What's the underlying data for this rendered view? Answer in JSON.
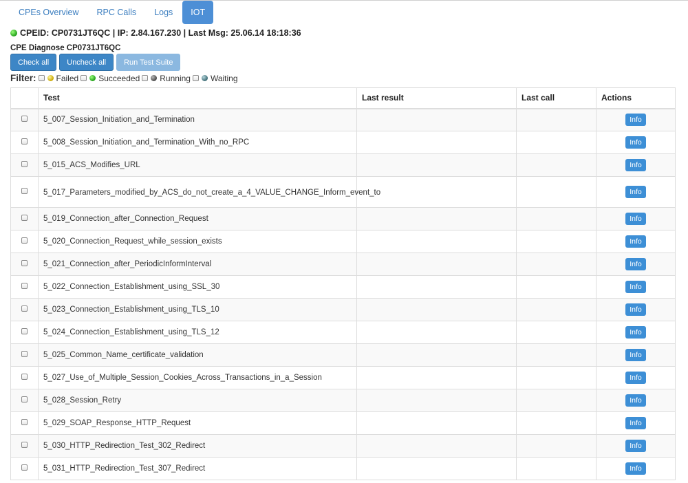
{
  "tabs": [
    {
      "label": "CPEs Overview",
      "active": false
    },
    {
      "label": "RPC Calls",
      "active": false
    },
    {
      "label": "Logs",
      "active": false
    },
    {
      "label": "IOT",
      "active": true
    }
  ],
  "status": {
    "text": "CPEID: CP0731JT6QC | IP: 2.84.167.230 | Last Msg: 25.06.14 18:18:36",
    "indicator_color": "#1f9e18"
  },
  "diagnose": {
    "title": "CPE Diagnose CP0731JT6QC",
    "buttons": {
      "check_all": "Check all",
      "uncheck_all": "Uncheck all",
      "run_suite": "Run Test Suite"
    }
  },
  "filter": {
    "label": "Filter:",
    "items": [
      {
        "label": "Failed",
        "icon": "yellow-dot-icon"
      },
      {
        "label": "Succeeded",
        "icon": "green-dot-icon"
      },
      {
        "label": "Running",
        "icon": "grey-dot-icon"
      },
      {
        "label": "Waiting",
        "icon": "teal-dot-icon"
      }
    ]
  },
  "table": {
    "headers": {
      "test": "Test",
      "last_result": "Last result",
      "last_call": "Last call",
      "actions": "Actions"
    },
    "info_label": "Info",
    "rows": [
      {
        "test": "5_007_Session_Initiation_and_Termination",
        "last_result": "",
        "last_call": ""
      },
      {
        "test": "5_008_Session_Initiation_and_Termination_With_no_RPC",
        "last_result": "",
        "last_call": ""
      },
      {
        "test": "5_015_ACS_Modifies_URL",
        "last_result": "",
        "last_call": ""
      },
      {
        "test": "5_017_Parameters_modified_by_ACS_do_not_create_a_4_VALUE_CHANGE_Inform_event_to",
        "last_result": "",
        "last_call": ""
      },
      {
        "test": "5_019_Connection_after_Connection_Request",
        "last_result": "",
        "last_call": ""
      },
      {
        "test": "5_020_Connection_Request_while_session_exists",
        "last_result": "",
        "last_call": ""
      },
      {
        "test": "5_021_Connection_after_PeriodicInformInterval",
        "last_result": "",
        "last_call": ""
      },
      {
        "test": "5_022_Connection_Establishment_using_SSL_30",
        "last_result": "",
        "last_call": ""
      },
      {
        "test": "5_023_Connection_Establishment_using_TLS_10",
        "last_result": "",
        "last_call": ""
      },
      {
        "test": "5_024_Connection_Establishment_using_TLS_12",
        "last_result": "",
        "last_call": ""
      },
      {
        "test": "5_025_Common_Name_certificate_validation",
        "last_result": "",
        "last_call": ""
      },
      {
        "test": "5_027_Use_of_Multiple_Session_Cookies_Across_Transactions_in_a_Session",
        "last_result": "",
        "last_call": ""
      },
      {
        "test": "5_028_Session_Retry",
        "last_result": "",
        "last_call": ""
      },
      {
        "test": "5_029_SOAP_Response_HTTP_Request",
        "last_result": "",
        "last_call": ""
      },
      {
        "test": "5_030_HTTP_Redirection_Test_302_Redirect",
        "last_result": "",
        "last_call": ""
      },
      {
        "test": "5_031_HTTP_Redirection_Test_307_Redirect",
        "last_result": "",
        "last_call": ""
      }
    ]
  }
}
